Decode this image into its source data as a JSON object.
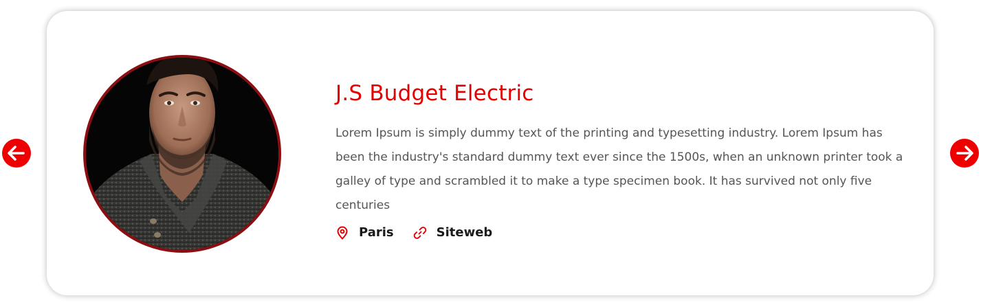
{
  "card": {
    "title": "J.S Budget Electric",
    "description": "Lorem Ipsum is simply dummy text of the printing and typesetting industry. Lorem Ipsum has been the industry's standard dummy text ever since the 1500s, when an unknown printer took a galley of type and scrambled it to make a type specimen book. It has survived not only five centuries",
    "location": {
      "icon": "map-pin-icon",
      "label": "Paris"
    },
    "website": {
      "icon": "link-icon",
      "label": "Siteweb"
    }
  },
  "navigation": {
    "prev_icon": "arrow-left-icon",
    "next_icon": "arrow-right-icon"
  },
  "colors": {
    "accent": "#e50000",
    "avatar_border": "#8b0f12",
    "body_text": "#555555",
    "meta_text": "#1a1a1a",
    "card_background": "#ffffff"
  }
}
